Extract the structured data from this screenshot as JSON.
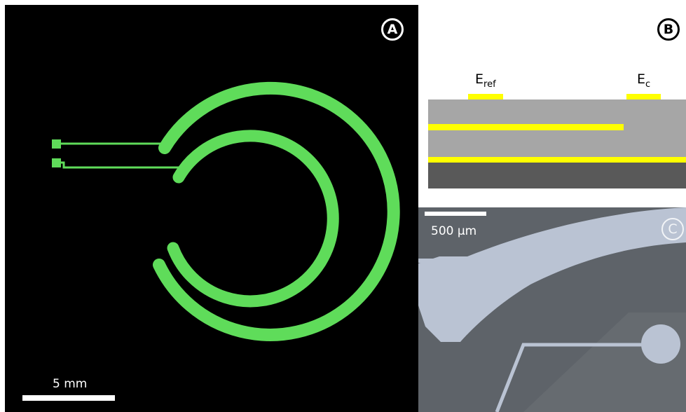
{
  "panels": {
    "a": {
      "label": "A",
      "scale_bar": "5 mm"
    },
    "b": {
      "label": "B",
      "electrode_ref": "E",
      "electrode_ref_sub": "ref",
      "electrode_c": "E",
      "electrode_c_sub": "c"
    },
    "c": {
      "label": "C",
      "scale_bar": "500 µm"
    }
  },
  "colors": {
    "electrode_green": "#5fdc5a",
    "layer_gray": "#a6a6a6",
    "substrate_dark": "#595959",
    "metal_yellow": "#ffff00",
    "micrograph_bg": "#5e6369",
    "micrograph_metal": "#bac3d3"
  }
}
